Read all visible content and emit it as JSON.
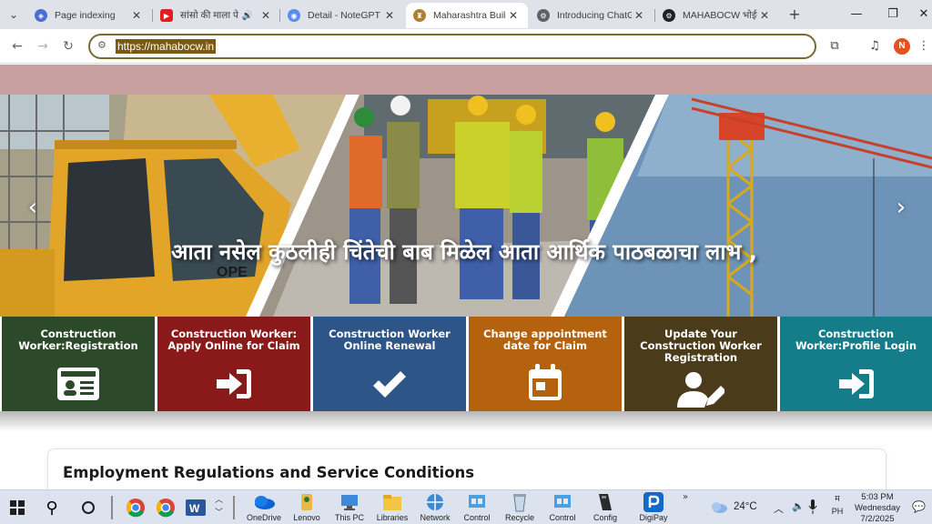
{
  "browser": {
    "tabs": [
      {
        "title": "Page indexing",
        "favicon": "google-search-console-icon",
        "active": false
      },
      {
        "title": "सांसो की माला पे",
        "favicon": "youtube-icon",
        "active": false,
        "audio": true
      },
      {
        "title": "Detail - NoteGPT V",
        "favicon": "notegpt-icon",
        "active": false
      },
      {
        "title": "Maharashtra Buildi",
        "favicon": "mahabocw-icon",
        "active": true
      },
      {
        "title": "Introducing ChatG",
        "favicon": "openai-icon",
        "active": false
      },
      {
        "title": "MAHABOCW भोईवे",
        "favicon": "openai-icon",
        "active": false
      }
    ],
    "url": "https://mahabocw.in",
    "profile_initial": "N"
  },
  "hero": {
    "caption": "आता नसेल कुठलीही चिंतेची बाब मिळेल आता आर्थिक पाठबळाचा लाभ ,",
    "crane_text": "OPE"
  },
  "tiles": [
    {
      "label": "Construction Worker:Registration",
      "color": "#2c4a2a",
      "icon": "id-card-icon"
    },
    {
      "label": "Construction Worker: Apply Online for Claim",
      "color": "#8a1a1a",
      "icon": "sign-in-icon"
    },
    {
      "label": "Construction Worker Online Renewal",
      "color": "#2d5588",
      "icon": "checkmark-icon"
    },
    {
      "label": "Change appointment date for Claim",
      "color": "#b5620e",
      "icon": "calendar-icon"
    },
    {
      "label": "Update Your Construction Worker Registration",
      "color": "#4a3b1a",
      "icon": "user-edit-icon"
    },
    {
      "label": "Construction Worker:Profile Login",
      "color": "#157d8a",
      "icon": "sign-in-icon"
    }
  ],
  "section": {
    "title": "Employment Regulations and Service Conditions"
  },
  "taskbar": {
    "apps": [
      {
        "label": "OneDrive",
        "icon": "onedrive-icon"
      },
      {
        "label": "Lenovo",
        "icon": "lenovo-icon"
      },
      {
        "label": "This PC",
        "icon": "this-pc-icon"
      },
      {
        "label": "Libraries",
        "icon": "libraries-icon"
      },
      {
        "label": "Network",
        "icon": "network-icon"
      },
      {
        "label": "Control",
        "icon": "control-panel-icon"
      },
      {
        "label": "Recycle",
        "icon": "recycle-bin-icon"
      },
      {
        "label": "Control",
        "icon": "control-panel-icon"
      },
      {
        "label": "Config",
        "icon": "config-icon"
      },
      {
        "label": "DigiPay",
        "icon": "digipay-icon"
      }
    ],
    "weather": "24°C",
    "lang_top": "म",
    "lang_bottom": "PH",
    "time": "5:03 PM",
    "day": "Wednesday",
    "date": "7/2/2025"
  }
}
